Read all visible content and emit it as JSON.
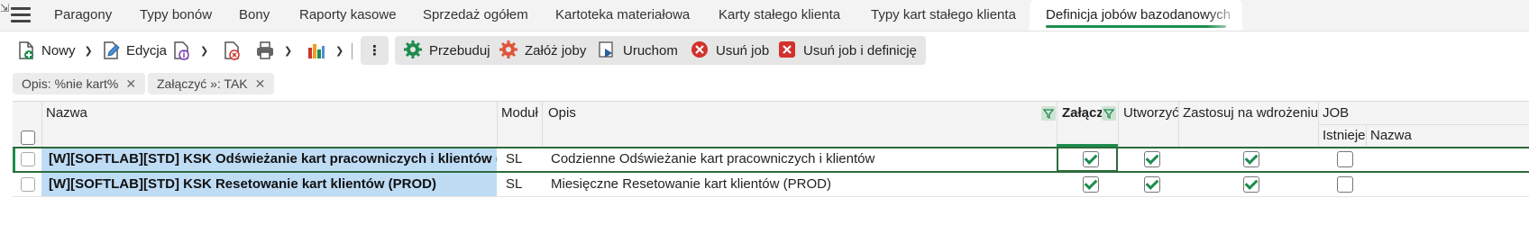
{
  "tabs": [
    {
      "label": "Paragony"
    },
    {
      "label": "Typy bonów"
    },
    {
      "label": "Bony"
    },
    {
      "label": "Raporty kasowe"
    },
    {
      "label": "Sprzedaż ogółem"
    },
    {
      "label": "Kartoteka materiałowa"
    },
    {
      "label": "Karty stałego klienta"
    },
    {
      "label": "Typy kart stałego klienta"
    },
    {
      "label": "Definicja jobów bazodanowych",
      "active": true
    }
  ],
  "toolbar": {
    "new_label": "Nowy",
    "edit_label": "Edycja",
    "rebuild_label": "Przebuduj",
    "create_jobs_label": "Załóż joby",
    "run_label": "Uruchom",
    "delete_job_label": "Usuń job",
    "delete_job_def_label": "Usuń job i definicję"
  },
  "filters": [
    {
      "label": "Opis: %nie kart%"
    },
    {
      "label": "Załączyć »: TAK"
    }
  ],
  "grid": {
    "headers": {
      "nazwa": "Nazwa",
      "modul": "Moduł",
      "opis": "Opis",
      "zalacz": "Załącz",
      "utworzyc": "Utworzyć",
      "zastosuj": "Zastosuj na wdrożeniu",
      "job": "JOB",
      "istnieje": "Istnieje",
      "job_nazwa": "Nazwa"
    },
    "rows": [
      {
        "nazwa": "[W][SOFTLAB][STD] KSK Odświeżanie kart pracowniczych i klientów (PROD)",
        "modul": "SL",
        "opis": "Codzienne Odświeżanie kart pracowniczych i klientów",
        "zalacz": true,
        "utworzyc": true,
        "zastosuj": true,
        "istnieje": false
      },
      {
        "nazwa": "[W][SOFTLAB][STD] KSK Resetowanie kart klientów (PROD)",
        "modul": "SL",
        "opis": "Miesięczne Resetowanie kart klientów (PROD)",
        "zalacz": true,
        "utworzyc": true,
        "zastosuj": true,
        "istnieje": false
      }
    ]
  },
  "colors": {
    "accent_green": "#1e8c4e",
    "selection_blue": "#bfdcf5",
    "button_bg": "#e6e6e6"
  },
  "icons": [
    "hamburger-icon",
    "new-document-icon",
    "edit-icon",
    "document-info-icon",
    "document-delete-icon",
    "print-icon",
    "chart-icon",
    "more-vert-icon",
    "gear-icon",
    "play-icon",
    "delete-circle-icon",
    "delete-square-icon",
    "filter-icon",
    "close-icon",
    "checkbox"
  ]
}
